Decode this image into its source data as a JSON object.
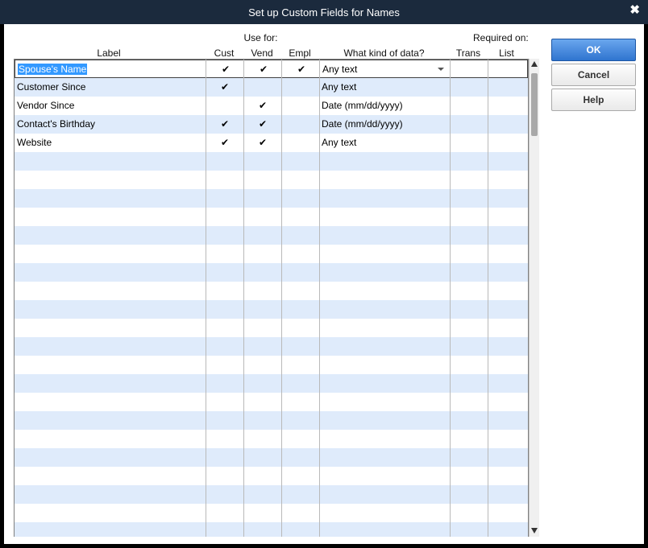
{
  "window": {
    "title": "Set up Custom Fields for Names",
    "close_glyph": "✖"
  },
  "headers": {
    "label": "Label",
    "use_for": "Use for:",
    "cust": "Cust",
    "vend": "Vend",
    "empl": "Empl",
    "kind": "What kind of data?",
    "required_on": "Required on:",
    "trans": "Trans",
    "list": "List"
  },
  "rows": [
    {
      "label": "Spouse's Name",
      "cust": "✔",
      "vend": "✔",
      "empl": "✔",
      "kind": "Any text",
      "trans": "",
      "list": ""
    },
    {
      "label": "Customer Since",
      "cust": "✔",
      "vend": "",
      "empl": "",
      "kind": "Any text",
      "trans": "",
      "list": ""
    },
    {
      "label": "Vendor Since",
      "cust": "",
      "vend": "✔",
      "empl": "",
      "kind": "Date (mm/dd/yyyy)",
      "trans": "",
      "list": ""
    },
    {
      "label": "Contact's Birthday",
      "cust": "✔",
      "vend": "✔",
      "empl": "",
      "kind": "Date (mm/dd/yyyy)",
      "trans": "",
      "list": ""
    },
    {
      "label": "Website",
      "cust": "✔",
      "vend": "✔",
      "empl": "",
      "kind": "Any text",
      "trans": "",
      "list": ""
    }
  ],
  "buttons": {
    "ok": "OK",
    "cancel": "Cancel",
    "help": "Help"
  },
  "icons": {
    "close": "close-icon",
    "dropdown": "chevron-down-icon",
    "scroll_up": "arrow-up-icon",
    "scroll_down": "arrow-down-icon"
  },
  "colors": {
    "titlebar": "#1b2a3d",
    "row_alt": "#dfebfb",
    "selection": "#3399ff",
    "ok_button": "#2f74cf"
  }
}
